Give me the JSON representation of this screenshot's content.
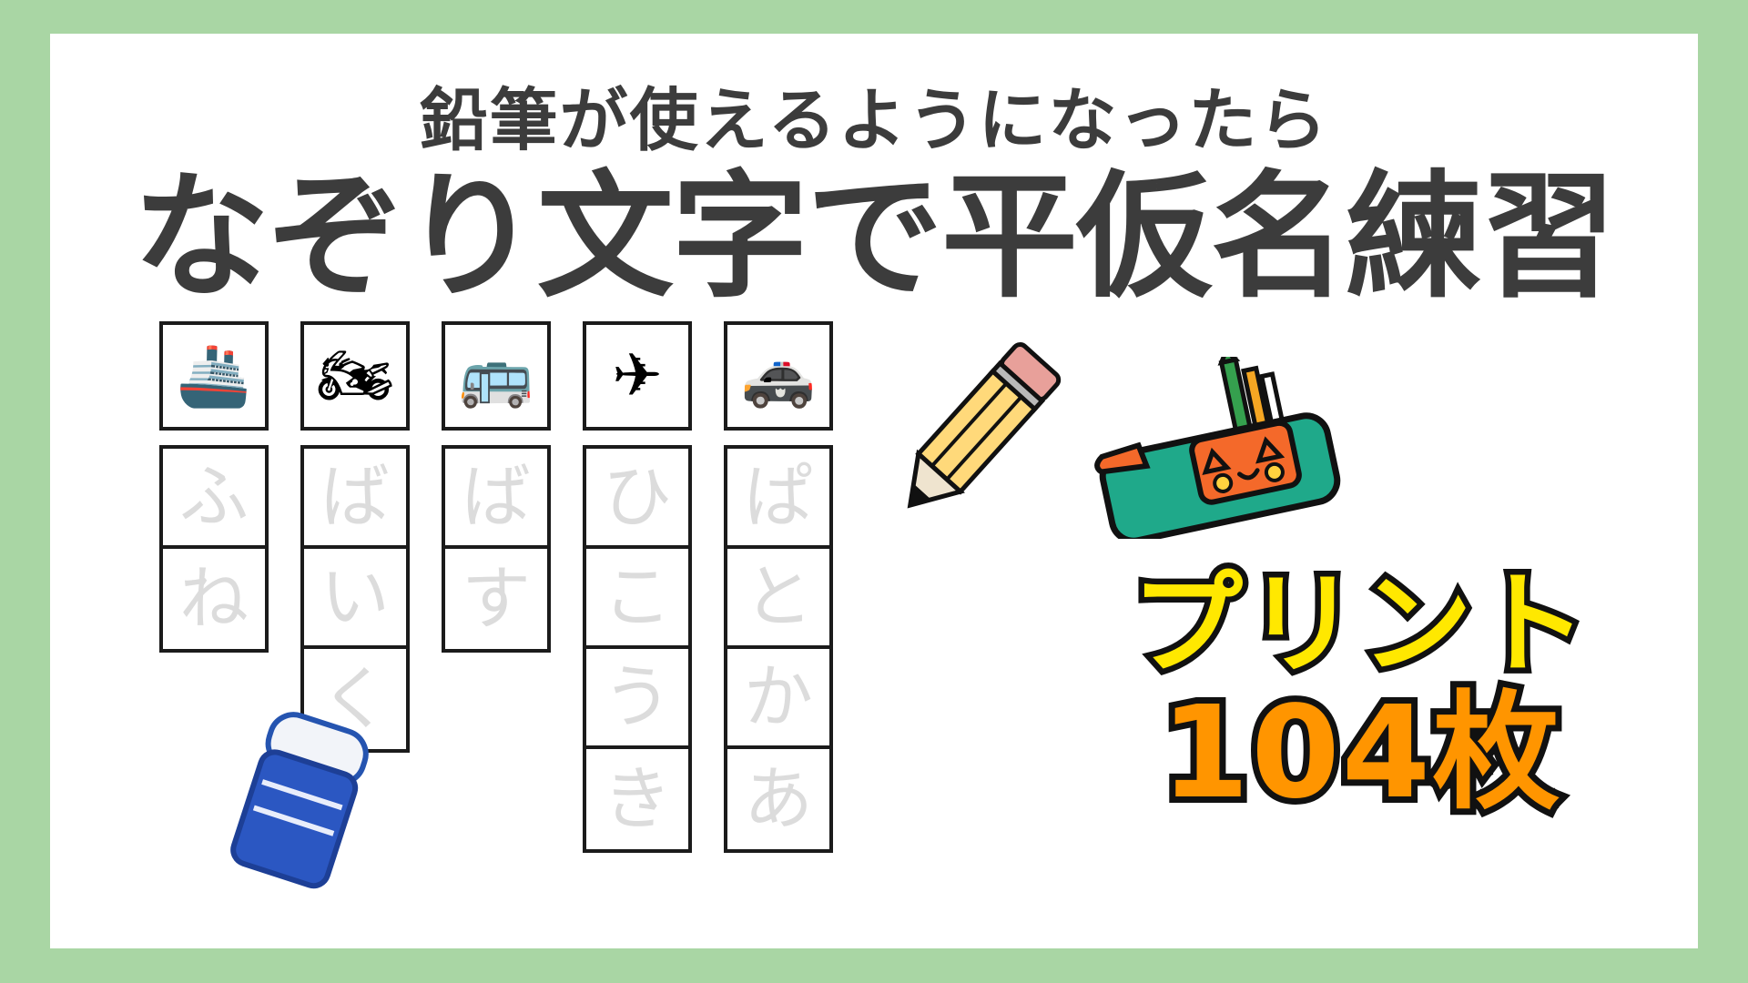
{
  "theme": {
    "background_color": "#a9d6a4",
    "card_color": "#ffffff",
    "title_color": "#3c3c3c",
    "trace_char_color": "#dcdcdc",
    "cell_border_color": "#1b1b1b",
    "promo_yellow": "#ffe800",
    "promo_orange": "#ff9500",
    "promo_outline": "#111111"
  },
  "header": {
    "subtitle": "鉛筆が使えるようになったら",
    "title": "なぞり文字で平仮名練習"
  },
  "worksheet": {
    "columns": [
      {
        "picture_icon": "ship-icon",
        "picture_glyph": "🚢",
        "word": "ふね",
        "characters": [
          "ふ",
          "ね"
        ]
      },
      {
        "picture_icon": "motorcycle-icon",
        "picture_glyph": "🏍",
        "word": "ばいく",
        "characters": [
          "ば",
          "い",
          "く"
        ]
      },
      {
        "picture_icon": "bus-icon",
        "picture_glyph": "🚌",
        "word": "ばす",
        "characters": [
          "ば",
          "す"
        ]
      },
      {
        "picture_icon": "airplane-icon",
        "picture_glyph": "✈",
        "word": "ひこうき",
        "characters": [
          "ひ",
          "こ",
          "う",
          "き"
        ]
      },
      {
        "picture_icon": "police-car-icon",
        "picture_glyph": "🚓",
        "word": "ぱとかあ",
        "characters": [
          "ぱ",
          "と",
          "か",
          "あ"
        ]
      }
    ]
  },
  "promo": {
    "line1": "プリント",
    "line2": "104枚"
  },
  "decorations": [
    {
      "name": "pencil-icon"
    },
    {
      "name": "eraser-icon"
    },
    {
      "name": "pencil-case-icon"
    }
  ]
}
